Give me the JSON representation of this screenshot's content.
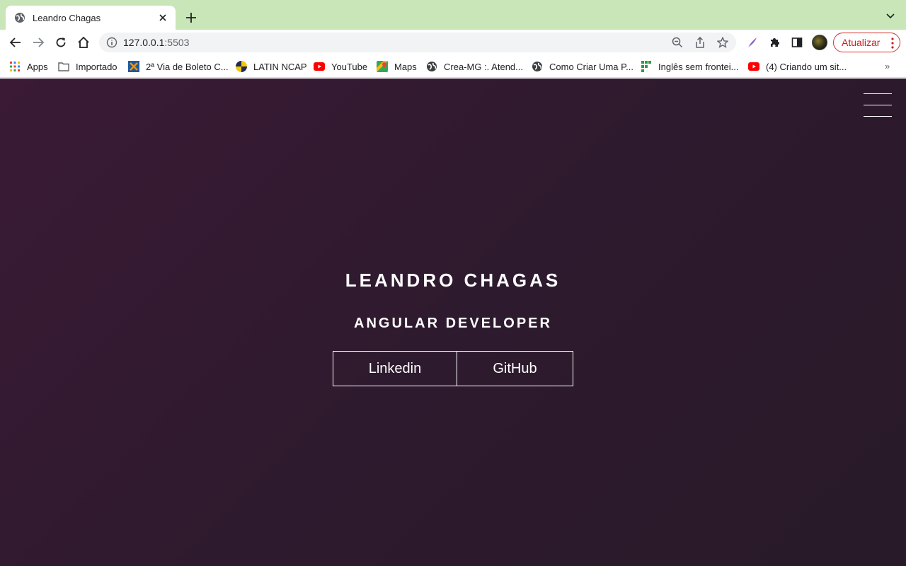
{
  "browser": {
    "tab": {
      "title": "Leandro Chagas"
    },
    "address": {
      "host": "127.0.0.1",
      "port": ":5503"
    },
    "update_label": "Atualizar",
    "bookmarks": [
      {
        "label": "Apps",
        "icon": "apps-grid-icon"
      },
      {
        "label": "Importado",
        "icon": "folder-icon"
      },
      {
        "label": "2ª Via de Boleto C...",
        "icon": "caixa-icon"
      },
      {
        "label": "LATIN NCAP",
        "icon": "latin-ncap-icon"
      },
      {
        "label": "YouTube",
        "icon": "youtube-icon"
      },
      {
        "label": "Maps",
        "icon": "maps-icon"
      },
      {
        "label": "Crea-MG :. Atend...",
        "icon": "globe-icon"
      },
      {
        "label": "Como Criar Uma P...",
        "icon": "globe-icon"
      },
      {
        "label": "Inglês sem frontei...",
        "icon": "green-blocks-icon"
      },
      {
        "label": "(4) Criando um sit...",
        "icon": "youtube-icon"
      }
    ],
    "bookmarks_more": "»"
  },
  "hero": {
    "name": "LEANDRO CHAGAS",
    "role": "ANGULAR DEVELOPER",
    "links": [
      {
        "label": "Linkedin"
      },
      {
        "label": "GitHub"
      }
    ]
  },
  "colors": {
    "tabstrip": "#c8e6b8",
    "page_bg": "#2e1a2e",
    "update_accent": "#c5221f"
  }
}
